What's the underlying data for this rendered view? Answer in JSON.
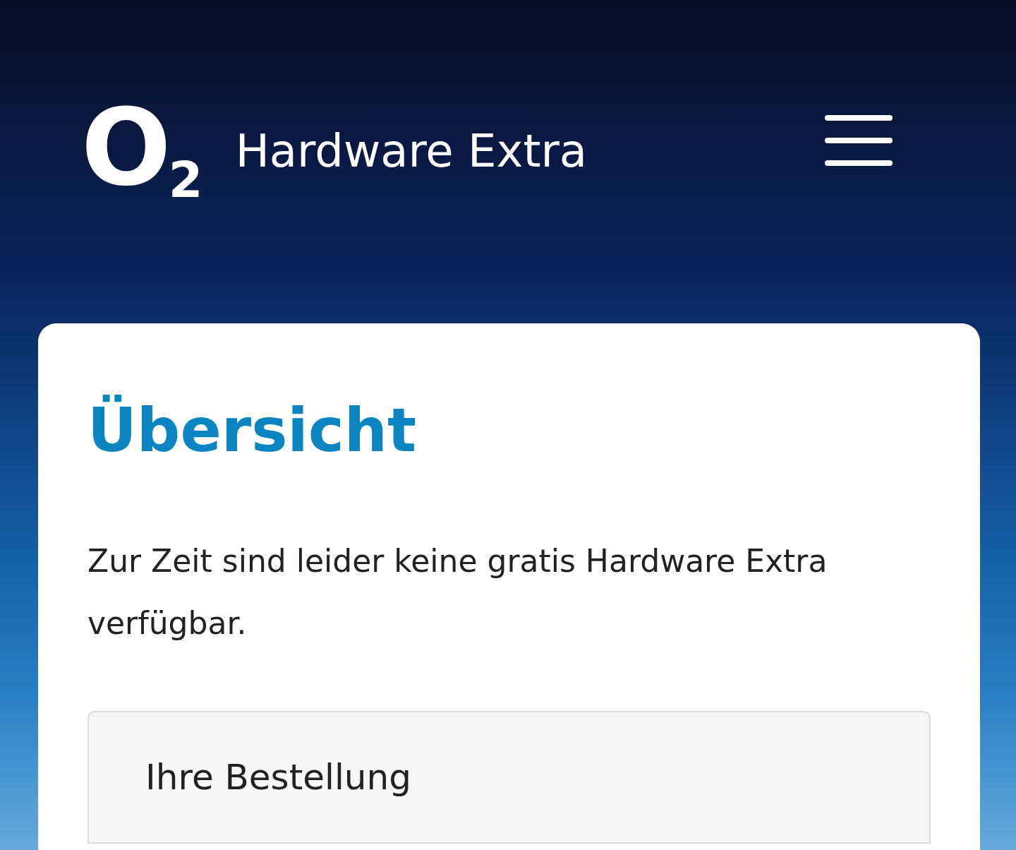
{
  "header": {
    "logo": "O$_{2}$",
    "title": "Hardware Extra"
  },
  "card": {
    "heading": "Übersicht",
    "message": "Zur Zeit sind leider keine gratis Hardware Extra verfügbar.",
    "sections": [
      {
        "label": "Ihre Bestellung"
      }
    ]
  }
}
